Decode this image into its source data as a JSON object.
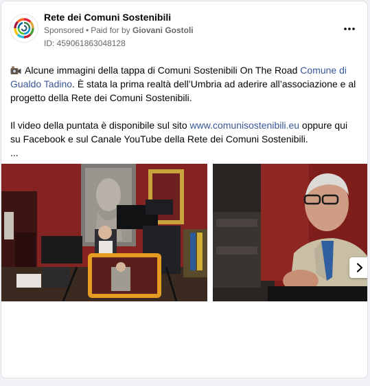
{
  "post": {
    "page_name": "Rete dei Comuni Sostenibili",
    "sponsored_label": "Sponsored",
    "separator": "•",
    "paid_for_prefix": "Paid for by",
    "paid_for_by": "Giovani Gostoli",
    "ad_id": "ID: 459061863048128",
    "avatar_icon": "sdg-wheel-logo",
    "more_icon": "more-options-icon"
  },
  "body": {
    "line1_prefix": "Alcune immagini della tappa di Comuni Sostenibili On The Road ",
    "line1_link": "Comune di Gualdo Tadino",
    "line1_suffix": ". È stata la prima realtà dell’Umbria ad aderire all’associazione e al progetto della Rete dei Comuni Sostenibili.",
    "line2_prefix": "Il video della puntata è disponibile sul sito ",
    "line2_link": "www.comunisostenibili.eu",
    "line2_suffix": " oppure qui su Facebook e sul Canale YouTube della Rete dei Comuni Sostenibili.",
    "truncation": "..."
  },
  "media": {
    "photo1": "video-shoot-photo",
    "photo2": "interview-portrait-photo",
    "next_icon": "chevron-right-icon"
  },
  "colors": {
    "link": "#385898",
    "text": "#050505",
    "secondary": "#65676b",
    "background": "#f0f2f5"
  }
}
